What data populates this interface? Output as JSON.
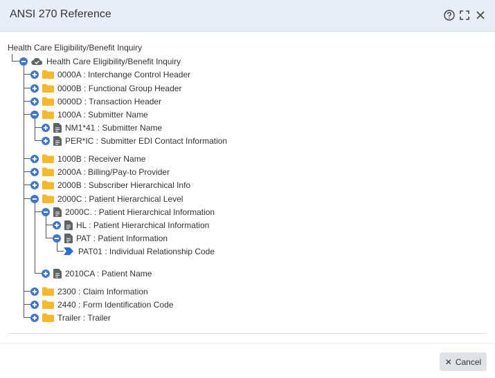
{
  "dialog": {
    "title": "ANSI 270 Reference",
    "cancel_label": "Cancel",
    "cancel_icon": "✕"
  },
  "tree": {
    "root_caption": "Health Care Eligibility/Benefit Inquiry",
    "root": "Health Care Eligibility/Benefit Inquiry",
    "n0000A": "0000A : Interchange Control Header",
    "n0000B": "0000B : Functional Group Header",
    "n0000D": "0000D : Transaction Header",
    "n1000A": "1000A : Submitter Name",
    "nNM1": "NM1*41 : Submitter Name",
    "nPER": "PER*IC : Submitter EDI Contact Information",
    "n1000B": "1000B : Receiver Name",
    "n2000A": "2000A : Billing/Pay-to Provider",
    "n2000B": "2000B : Subscriber Hierarchical Info",
    "n2000C": "2000C : Patient Hierarchical Level",
    "n2000Cdot": "2000C. : Patient Hierarchical Information",
    "nHL": "HL : Patient Hierarchical Information",
    "nPAT": "PAT : Patient Information",
    "nPAT01": "PAT01 : Individual Relationship Code",
    "n2010CA": "2010CA : Patient Name",
    "n2300": "2300 : Claim Information",
    "n2440": "2440 : Form Identification Code",
    "nTrailer": "Trailer : Trailer"
  },
  "colors": {
    "toggle": "#3f78c9",
    "folder": "#f5b82e",
    "doc": "#5f6368",
    "element": "#2b6fd6",
    "header_bg": "#e8eef8"
  }
}
